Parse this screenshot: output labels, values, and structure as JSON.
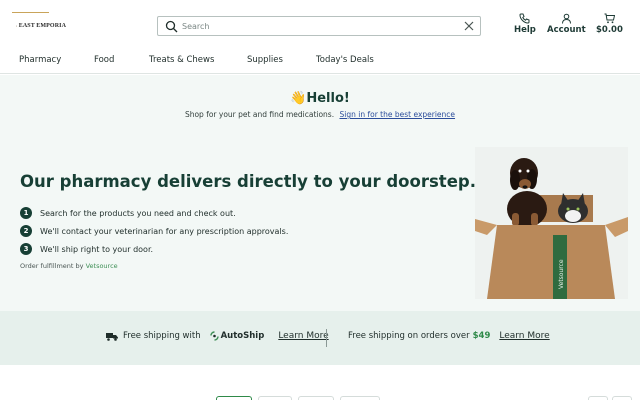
{
  "brand": {
    "logo_text": "EAST EMPORIA",
    "accent_color": "#173f35",
    "link_color": "#2b4d9b",
    "price_color": "#2f8a49"
  },
  "search": {
    "placeholder": "Search",
    "value": ""
  },
  "header_nav": {
    "help": {
      "label": "Help",
      "icon": "phone-icon"
    },
    "account": {
      "label": "Account",
      "icon": "user-icon"
    },
    "cart": {
      "label": "$0.00",
      "icon": "cart-icon"
    }
  },
  "categories": [
    "Pharmacy",
    "Food",
    "Treats & Chews",
    "Supplies",
    "Today's Deals"
  ],
  "hero": {
    "greeting_emoji": "👋",
    "greeting": "Hello!",
    "subtitle": "Shop for your pet and find medications.",
    "signin_link": "Sign in for the best experience",
    "headline": "Our pharmacy delivers directly to your doorstep.",
    "steps": [
      {
        "num": "1",
        "text": "Search for the products you need and check out."
      },
      {
        "num": "2",
        "text": "We'll contact your veterinarian for any prescription approvals."
      },
      {
        "num": "3",
        "text": "We'll ship right to your door."
      }
    ],
    "fulfillment_prefix": "Order fulfillment by",
    "fulfillment_partner": "Vetsource",
    "box_label": "Vetsource"
  },
  "banner": {
    "autoship_prefix": "Free shipping with",
    "autoship_brand": "AutoShip",
    "learn_more_1": "Learn More",
    "orders_prefix": "Free shipping on orders over",
    "orders_amount": "$49",
    "learn_more_2": "Learn More"
  }
}
